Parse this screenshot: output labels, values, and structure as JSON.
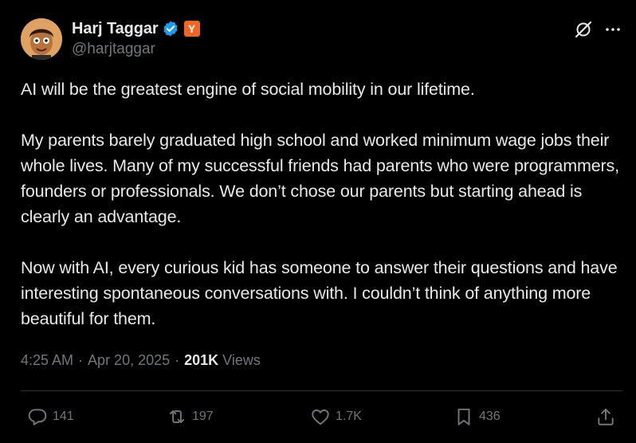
{
  "author": {
    "display_name": "Harj Taggar",
    "handle": "@harjtaggar",
    "badge_letter": "Y",
    "verified_color": "#1d9bf0",
    "badge_color": "#f26522"
  },
  "tweet": {
    "paragraphs": [
      "AI will be the greatest engine of social mobility in our lifetime.",
      "My parents barely graduated high school and worked minimum wage jobs their whole lives. Many of my successful friends had parents who were programmers, founders or professionals. We don’t chose our parents but starting ahead is clearly an advantage.",
      "Now with AI, every curious kid has someone to answer their questions and have interesting spontaneous conversations with. I couldn’t think of anything more beautiful for them."
    ],
    "time": "4:25 AM",
    "separator": "·",
    "date": "Apr 20, 2025",
    "views_count": "201K",
    "views_label": "Views"
  },
  "actions": {
    "replies": "141",
    "reposts": "197",
    "likes": "1.7K",
    "bookmarks": "436"
  },
  "icons": {
    "top_right": [
      "grok-icon",
      "more-icon"
    ],
    "action_bar": [
      "reply-icon",
      "repost-icon",
      "like-icon",
      "bookmark-icon",
      "share-icon"
    ]
  }
}
